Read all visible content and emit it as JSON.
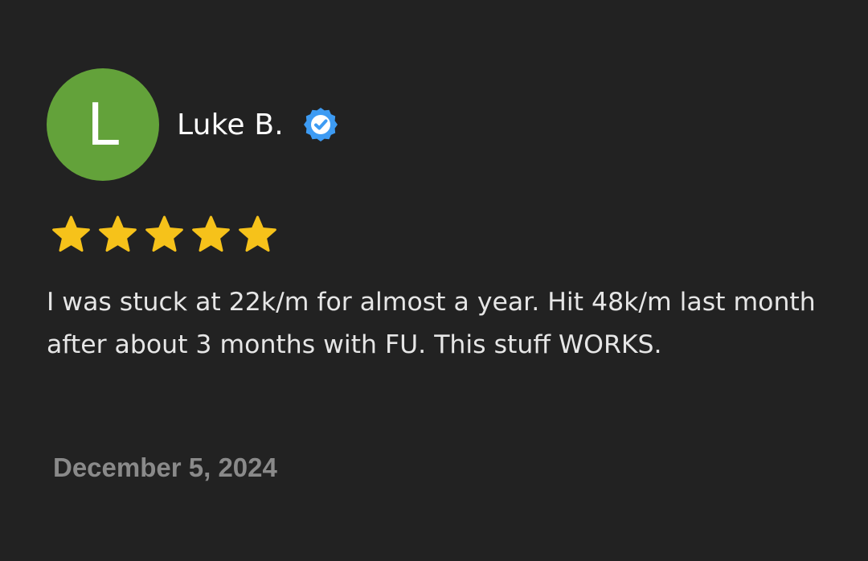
{
  "review": {
    "avatar_letter": "L",
    "avatar_color": "#63a23a",
    "reviewer_name": "Luke B.",
    "verified_icon": "verified-badge-icon",
    "verified_color": "#3d9bf3",
    "rating": 5,
    "rating_max": 5,
    "star_color": "#f6c21a",
    "text": "I was stuck at 22k/m for almost a year. Hit 48k/m last month after about 3 months with FU. This stuff WORKS.",
    "date": "December 5, 2024"
  },
  "colors": {
    "background": "#222222",
    "text": "#e6e6e6",
    "date_text": "#8a8a8a"
  }
}
